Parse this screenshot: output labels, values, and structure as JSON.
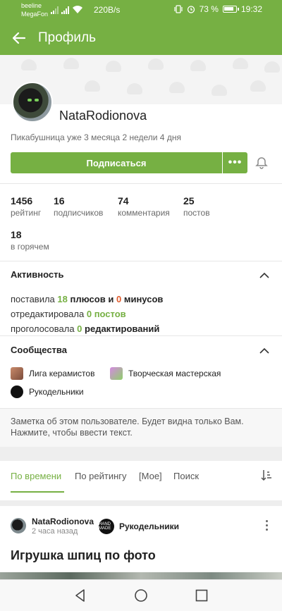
{
  "status_bar": {
    "carrier1": "beeline",
    "carrier2": "MegaFon",
    "net_speed": "220B/s",
    "battery": "73 %",
    "time": "19:32"
  },
  "app_bar": {
    "title": "Профиль"
  },
  "profile": {
    "username": "NataRodionova",
    "member_since": "Пикабушница уже 3 месяца 2 недели 4 дня",
    "subscribe_label": "Подписаться",
    "more_label": "•••"
  },
  "stats": [
    {
      "value": "1456",
      "label": "рейтинг"
    },
    {
      "value": "16",
      "label": "подписчиков"
    },
    {
      "value": "74",
      "label": "комментария"
    },
    {
      "value": "25",
      "label": "постов"
    },
    {
      "value": "18",
      "label": "в горячем"
    }
  ],
  "activity": {
    "title": "Активность",
    "line1": {
      "prefix": "поставила",
      "pluses": "18",
      "pluses_word": "плюсов",
      "and": "и",
      "minuses": "0",
      "minuses_word": "минусов"
    },
    "line2": {
      "prefix": "отредактировала",
      "count": "0",
      "word": "постов"
    },
    "line3": {
      "prefix": "проголосовала",
      "count": "0",
      "word": "редактирований"
    }
  },
  "communities": {
    "title": "Сообщества",
    "items": [
      {
        "label": "Лига керамистов"
      },
      {
        "label": "Творческая мастерская"
      },
      {
        "label": "Рукодельники"
      }
    ]
  },
  "note": {
    "text": "Заметка об этом пользователе. Будет видна только Вам. Нажмите, чтобы ввести текст."
  },
  "tabs": [
    {
      "label": "По времени"
    },
    {
      "label": "По рейтингу"
    },
    {
      "label": "[Мое]"
    },
    {
      "label": "Поиск"
    }
  ],
  "post": {
    "author": "NataRodionova",
    "time": "2 часа назад",
    "community": "Рукодельники",
    "community_badge": "HAND MADE",
    "title": "Игрушка шпиц по фото"
  },
  "colors": {
    "accent": "#76b043",
    "minus": "#e05a2b"
  }
}
